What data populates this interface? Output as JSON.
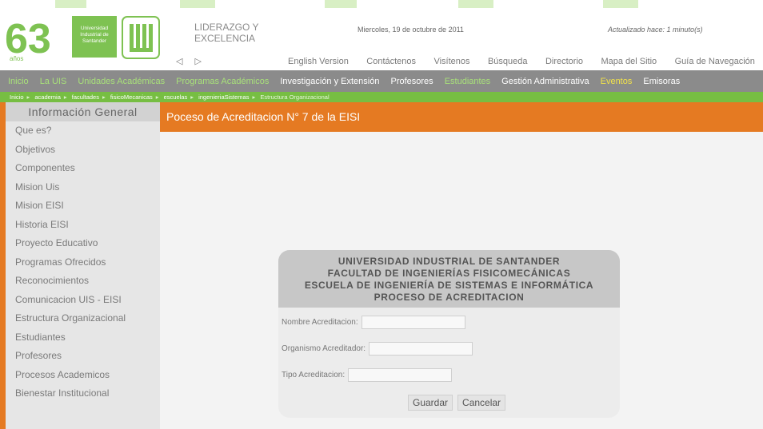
{
  "colors": {
    "accent_orange": "#e57a22",
    "brand_green": "#77be43",
    "nav_gray": "#8b8b8b",
    "nav_white_text": "#ffffff",
    "nav_green_text": "#a8e07a",
    "nav_yellow_text": "#f2e24a"
  },
  "header": {
    "logo_number": "63",
    "logo_caption": "años",
    "university_box": "Universidad Industrial de Santander",
    "lema_line1": "LIDERAZGO Y",
    "lema_line2": "EXCELENCIA",
    "date": "Miercoles, 19 de octubre de 2011",
    "updated": "Actualizado hace: 1 minuto(s)",
    "prev_icon": "prev-arrow-icon",
    "next_icon": "next-arrow-icon",
    "top_links": [
      "English Version",
      "Contáctenos",
      "Visítenos",
      "Búsqueda",
      "Directorio",
      "Mapa del Sitio",
      "Guía de Navegación"
    ]
  },
  "main_nav": [
    {
      "label": "Inicio",
      "color": "#a8e07a"
    },
    {
      "label": "La UIS",
      "color": "#a8e07a"
    },
    {
      "label": "Unidades Académicas",
      "color": "#a8e07a"
    },
    {
      "label": "Programas Académicos",
      "color": "#a8e07a"
    },
    {
      "label": "Investigación y Extensión",
      "color": "#ffffff"
    },
    {
      "label": "Profesores",
      "color": "#ffffff"
    },
    {
      "label": "Estudiantes",
      "color": "#a8e07a"
    },
    {
      "label": "Gestión Administrativa",
      "color": "#ffffff"
    },
    {
      "label": "Eventos",
      "color": "#f2e24a"
    },
    {
      "label": "Emisoras",
      "color": "#ffffff"
    }
  ],
  "breadcrumb": [
    "Inicio",
    "academia",
    "facultades",
    "fisicoMecanicas",
    "escuelas",
    "ingenieriaSistemas",
    "Estructura Organizacional"
  ],
  "sidebar": {
    "title": "Información General",
    "items": [
      "Que es?",
      "Objetivos",
      "Componentes",
      "Mision Uis",
      "Mision EISI",
      "Historia EISI",
      "Proyecto Educativo",
      "Programas Ofrecidos",
      "Reconocimientos",
      "Comunicacion UIS - EISI",
      "Estructura Organizacional",
      "Estudiantes",
      "Profesores",
      "Procesos Academicos",
      "Bienestar Institucional"
    ]
  },
  "content": {
    "title": "Poceso de Acreditacion N° 7 de la EISI"
  },
  "form": {
    "head_line1": "UNIVERSIDAD INDUSTRIAL DE SANTANDER",
    "head_line2": "FACULTAD DE INGENIERÍAS FISICOMECÁNICAS",
    "head_line3": "ESCUELA DE INGENIERÍA DE SISTEMAS E INFORMÁTICA",
    "head_line4": "PROCESO DE ACREDITACION",
    "field1_label": "Nombre Acreditacion:",
    "field1_value": "",
    "field2_label": "Organismo Acreditador:",
    "field2_value": "",
    "field3_label": "Tipo Acreditacion:",
    "field3_value": "",
    "save_label": "Guardar",
    "cancel_label": "Cancelar"
  }
}
